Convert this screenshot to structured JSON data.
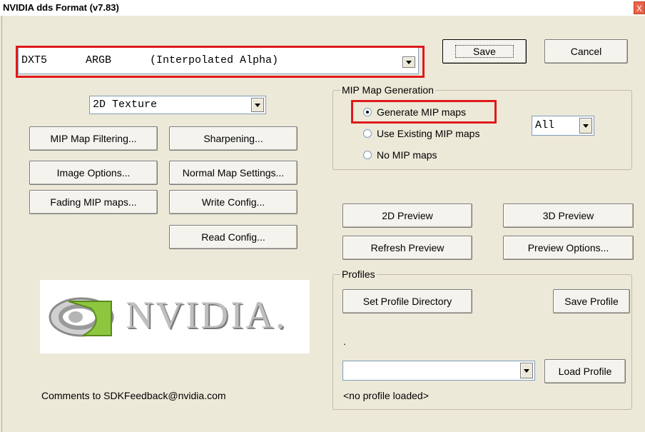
{
  "window": {
    "title": "NVIDIA dds Format (v7.83)",
    "close_label": "X"
  },
  "format_combo": {
    "value": "DXT5      ARGB      (Interpolated Alpha)"
  },
  "texture_combo": {
    "value": "2D Texture"
  },
  "buttons": {
    "save": "Save",
    "cancel": "Cancel",
    "mip_filtering": "MIP Map Filtering...",
    "sharpening": "Sharpening...",
    "image_options": "Image Options...",
    "normal_map": "Normal Map Settings...",
    "fading_mip": "Fading MIP maps...",
    "write_config": "Write Config...",
    "read_config": "Read Config...",
    "preview_2d": "2D Preview",
    "preview_3d": "3D Preview",
    "refresh_preview": "Refresh Preview",
    "preview_options": "Preview Options...",
    "set_profile_dir": "Set Profile Directory",
    "save_profile": "Save Profile",
    "load_profile": "Load Profile"
  },
  "mip_group": {
    "title": "MIP Map Generation",
    "options": [
      "Generate MIP maps",
      "Use Existing MIP maps",
      "No MIP maps"
    ],
    "selected": "Generate MIP maps",
    "levels_value": "All"
  },
  "profiles_group": {
    "title": "Profiles",
    "directory_text": ".",
    "profile_combo_value": "",
    "status": "<no profile loaded>"
  },
  "logo": {
    "text": "NVIDIA."
  },
  "feedback": "Comments to SDKFeedback@nvidia.com",
  "colors": {
    "highlight": "#e0191c",
    "window_bg": "#ece9d8",
    "logo_green": "#8dc63f"
  },
  "icons": {
    "logo_mark": "nvidia-eye-icon",
    "dropdown": "chevron-down-icon",
    "close": "close-icon"
  }
}
